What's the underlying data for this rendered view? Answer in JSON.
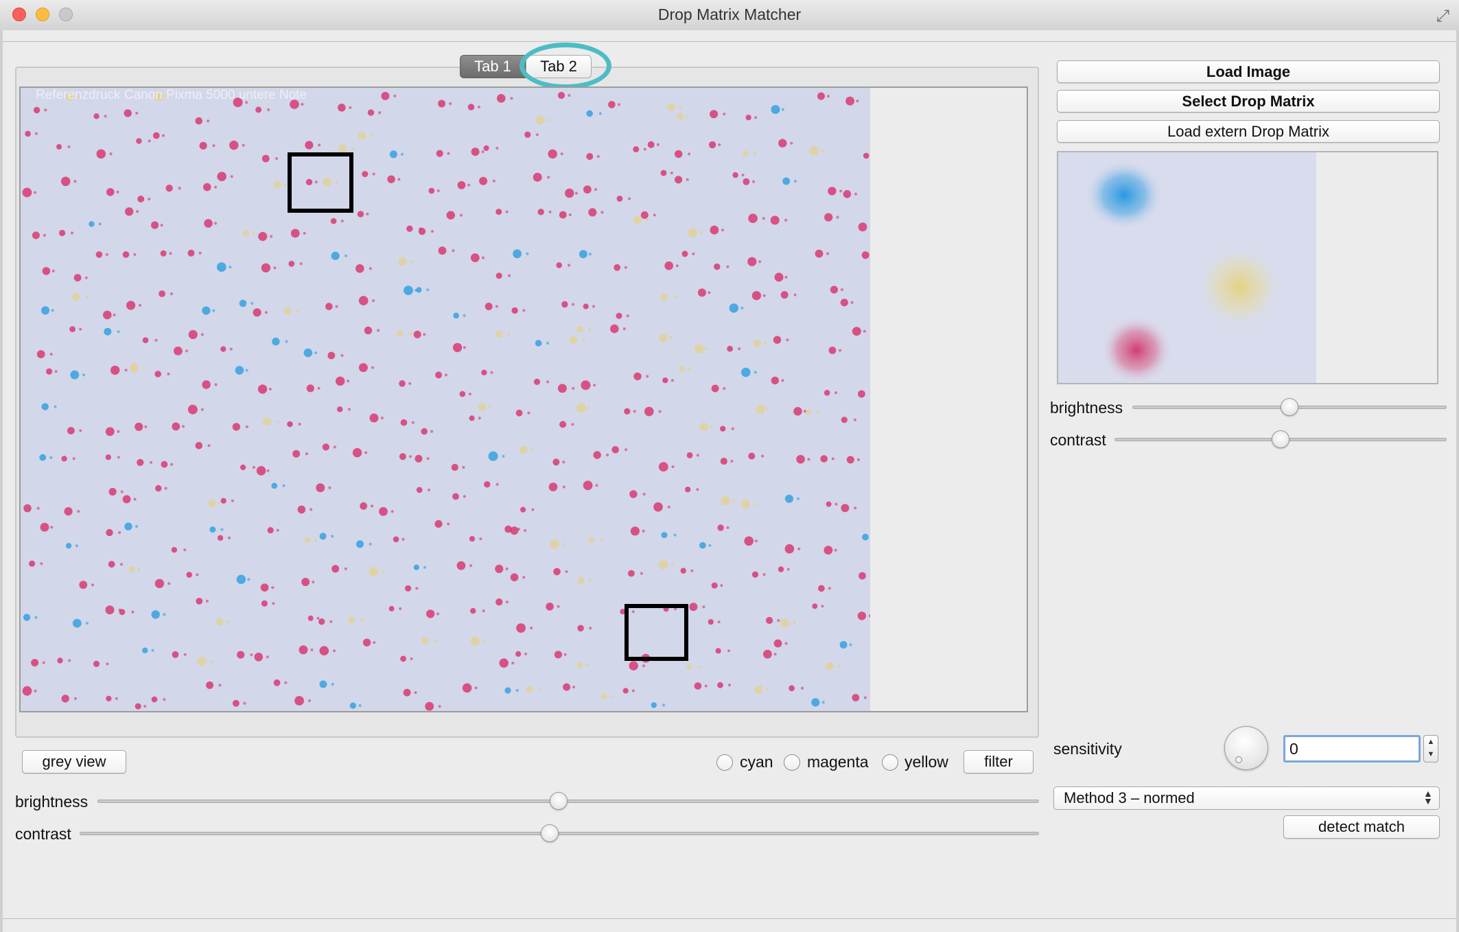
{
  "window": {
    "title": "Drop Matrix Matcher"
  },
  "tabs": [
    {
      "label": "Tab 1",
      "selected": true
    },
    {
      "label": "Tab 2",
      "selected": false
    }
  ],
  "image_view": {
    "caption": "Referenzdruck Canon Pixma 5000 untere Note"
  },
  "left_controls": {
    "grey_view_label": "grey view",
    "color_filters": [
      {
        "label": "cyan",
        "checked": false
      },
      {
        "label": "magenta",
        "checked": false
      },
      {
        "label": "yellow",
        "checked": false
      }
    ],
    "filter_label": "filter",
    "brightness": {
      "label": "brightness",
      "value": 0.49
    },
    "contrast": {
      "label": "contrast",
      "value": 0.49
    }
  },
  "right_panel": {
    "load_image_label": "Load Image",
    "select_drop_matrix_label": "Select Drop Matrix",
    "load_extern_label": "Load extern Drop Matrix",
    "brightness": {
      "label": "brightness",
      "value": 0.5
    },
    "contrast": {
      "label": "contrast",
      "value": 0.5
    },
    "sensitivity": {
      "label": "sensitivity",
      "value": "0"
    },
    "method": {
      "selected": "Method 3 – normed"
    },
    "detect_match_label": "detect match"
  },
  "colors": {
    "tab_highlight": "#4cbdc4",
    "dot_magenta": "#d9306a",
    "dot_cyan": "#2c9ddf",
    "dot_yellow": "#e9cf6a"
  }
}
